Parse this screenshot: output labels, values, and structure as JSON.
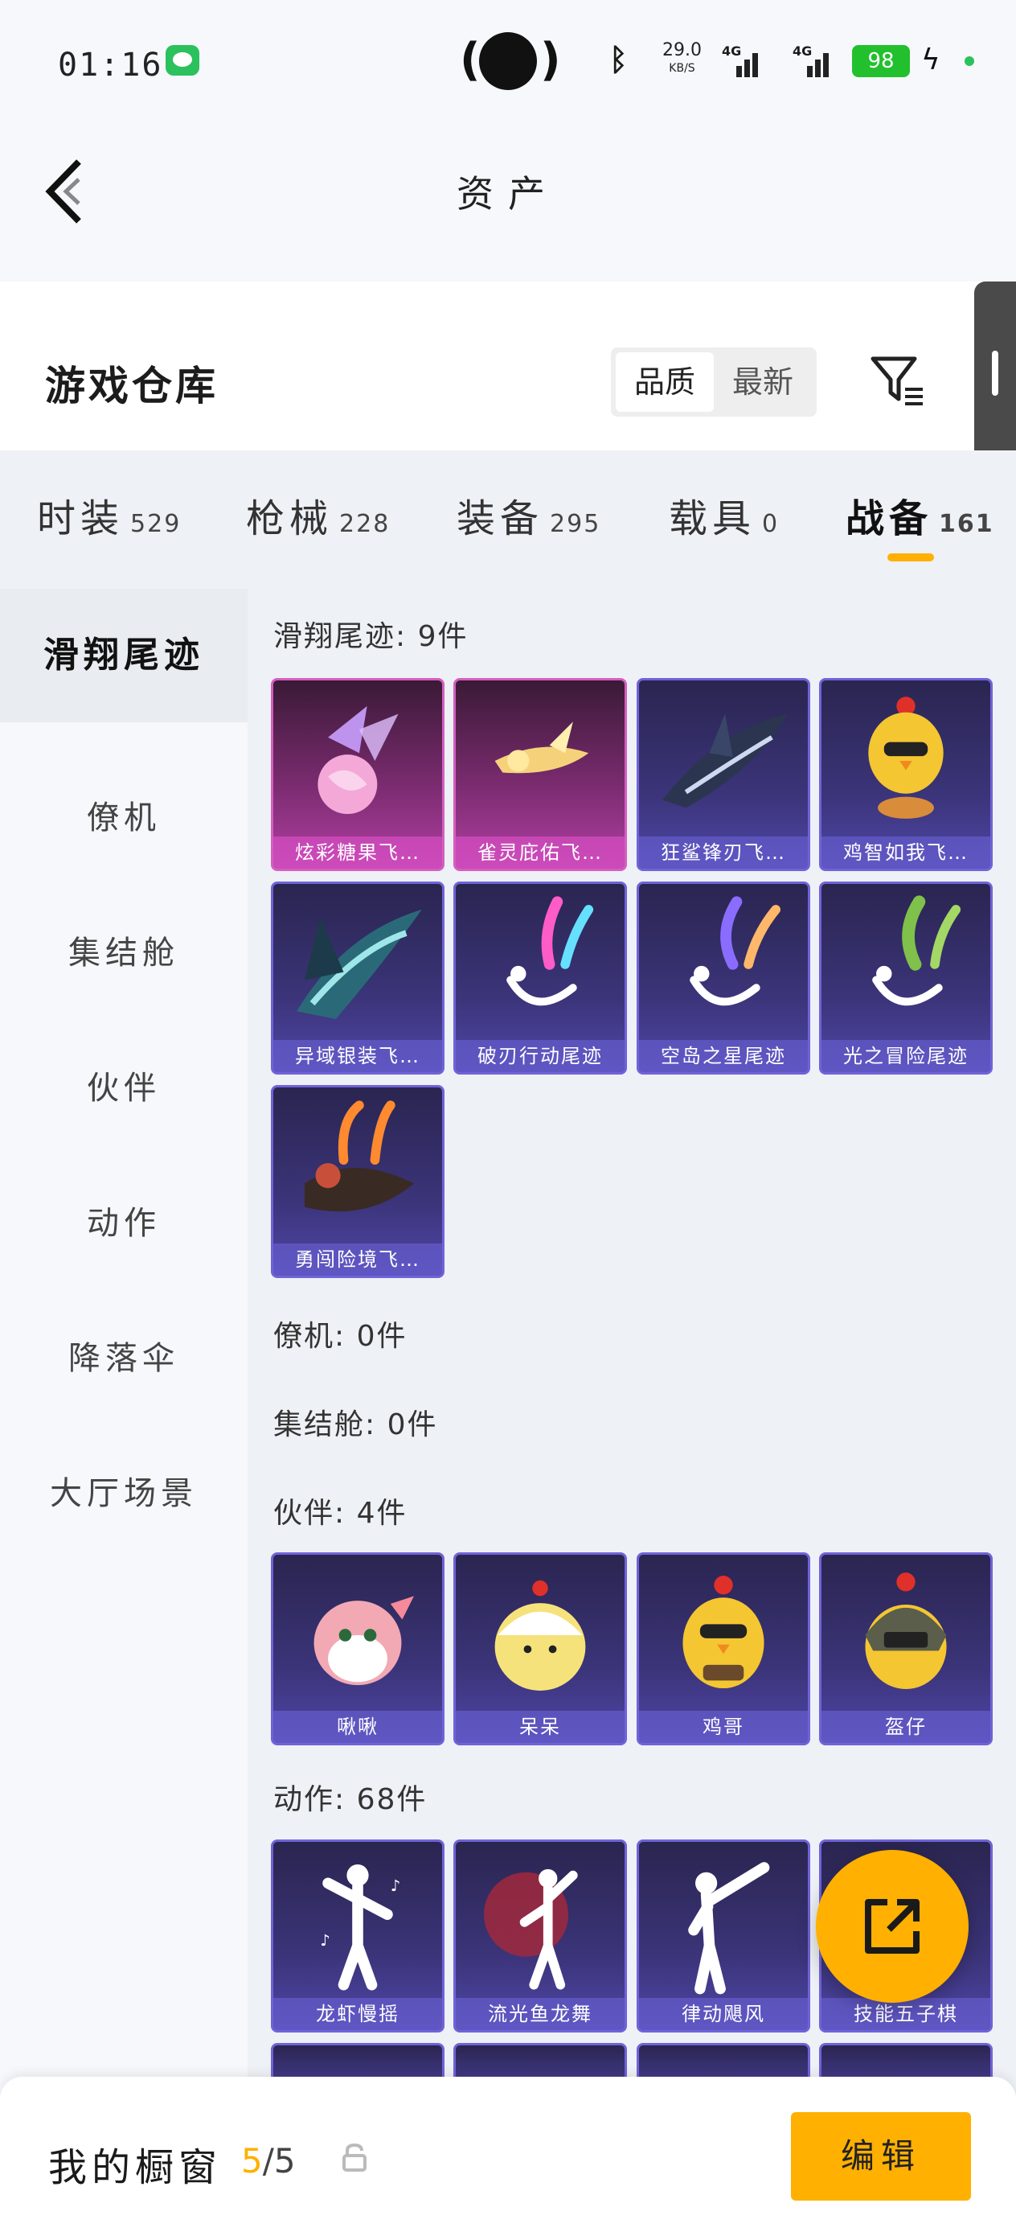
{
  "status_bar": {
    "time": "01:16",
    "net_speed_value": "29.0",
    "net_speed_unit": "KB/S",
    "signal1_label": "4G",
    "signal2_label": "4G",
    "battery": "98"
  },
  "header": {
    "title": "资产"
  },
  "warehouse": {
    "title": "游戏仓库",
    "sort_options": [
      "品质",
      "最新"
    ],
    "active_sort": "品质"
  },
  "tabs": [
    {
      "label": "时装",
      "count": "529"
    },
    {
      "label": "枪械",
      "count": "228"
    },
    {
      "label": "装备",
      "count": "295"
    },
    {
      "label": "载具",
      "count": "0"
    },
    {
      "label": "战备",
      "count": "161",
      "active": true
    }
  ],
  "sidebar": [
    "滑翔尾迹",
    "僚机",
    "集结舱",
    "伙伴",
    "动作",
    "降落伞",
    "大厅场景"
  ],
  "sections": {
    "glide_trail": {
      "title": "滑翔尾迹: 9件",
      "items": [
        "炫彩糖果飞…",
        "雀灵庇佑飞…",
        "狂鲨锋刃飞…",
        "鸡智如我飞…",
        "异域银装飞…",
        "破刃行动尾迹",
        "空岛之星尾迹",
        "光之冒险尾迹",
        "勇闯险境飞…"
      ]
    },
    "wingman": {
      "title": "僚机: 0件"
    },
    "assembly_pod": {
      "title": "集结舱: 0件"
    },
    "partner": {
      "title": "伙伴: 4件",
      "items": [
        "啾啾",
        "呆呆",
        "鸡哥",
        "盔仔"
      ]
    },
    "action": {
      "title": "动作: 68件",
      "items": [
        "龙虾慢摇",
        "流光鱼龙舞",
        "律动飓风",
        "技能五子棋"
      ]
    }
  },
  "bottom_bar": {
    "label": "我的橱窗",
    "slots_current": "5",
    "slots_sep": "/",
    "slots_total": "5",
    "edit_label": "编辑"
  },
  "colors": {
    "accent": "#ffb000",
    "card_purple": "#3b3479",
    "card_pink": "#b13fa3"
  }
}
